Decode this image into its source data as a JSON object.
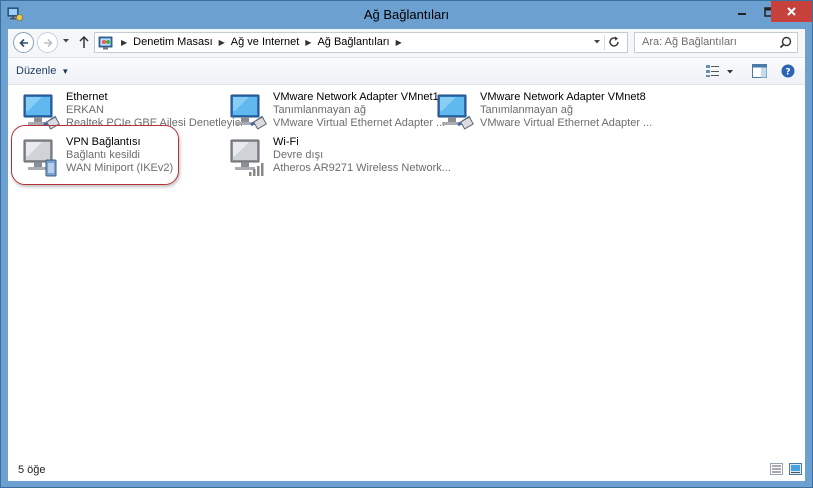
{
  "window": {
    "title": "Ağ Bağlantıları"
  },
  "nav": {
    "breadcrumbs": [
      "Denetim Masası",
      "Ağ ve Internet",
      "Ağ Bağlantıları"
    ],
    "search_placeholder": "Ara: Ağ Bağlantıları"
  },
  "toolbar": {
    "organize_label": "Düzenle"
  },
  "connections": [
    {
      "name": "Ethernet",
      "status": "ERKAN",
      "device": "Realtek PCIe GBE Ailesi Denetleyici",
      "icon": "ethernet-adapter-icon"
    },
    {
      "name": "VMware Network Adapter VMnet1",
      "status": "Tanımlanmayan ağ",
      "device": "VMware Virtual Ethernet Adapter ...",
      "icon": "vmware-adapter-icon"
    },
    {
      "name": "VMware Network Adapter VMnet8",
      "status": "Tanımlanmayan ağ",
      "device": "VMware Virtual Ethernet Adapter ...",
      "icon": "vmware-adapter-icon"
    },
    {
      "name": "VPN Bağlantısı",
      "status": "Bağlantı kesildi",
      "device": "WAN Miniport (IKEv2)",
      "icon": "vpn-adapter-icon"
    },
    {
      "name": "Wi-Fi",
      "status": "Devre dışı",
      "device": "Atheros AR9271 Wireless Network...",
      "icon": "wifi-adapter-icon"
    }
  ],
  "status": {
    "item_count": "5 öğe"
  },
  "colors": {
    "frame": "#6ca0d0",
    "close_button": "#c7413c",
    "highlight_ring": "#b5323a"
  }
}
